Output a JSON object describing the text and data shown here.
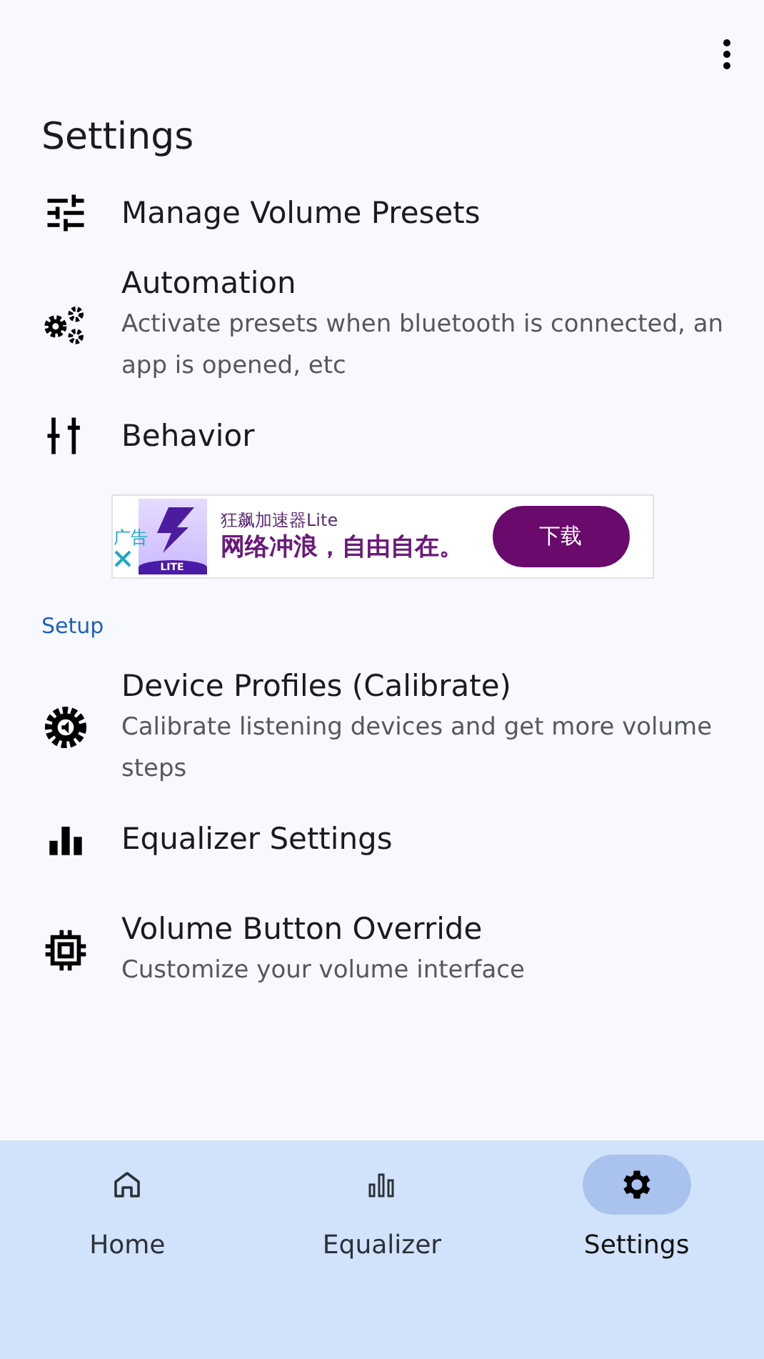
{
  "title": "Settings",
  "groups": [
    {
      "items": [
        {
          "title": "Manage Volume Presets"
        },
        {
          "title": "Automation",
          "subtitle": "Activate presets when bluetooth is connected, an app is opened, etc"
        },
        {
          "title": "Behavior"
        }
      ]
    },
    {
      "header": "Setup",
      "items": [
        {
          "title": "Device Profiles (Calibrate)",
          "subtitle": "Calibrate listening devices and get more volume steps"
        },
        {
          "title": "Equalizer Settings"
        },
        {
          "title": "Volume Button Override",
          "subtitle": "Customize your volume interface"
        }
      ]
    }
  ],
  "ad": {
    "tag": "广告",
    "logo_text": "LITE",
    "app_name": "狂飙加速器Lite",
    "slogan": "网络冲浪，自由自在。",
    "button": "下载"
  },
  "nav": [
    {
      "label": "Home",
      "selected": false
    },
    {
      "label": "Equalizer",
      "selected": false
    },
    {
      "label": "Settings",
      "selected": true
    }
  ]
}
